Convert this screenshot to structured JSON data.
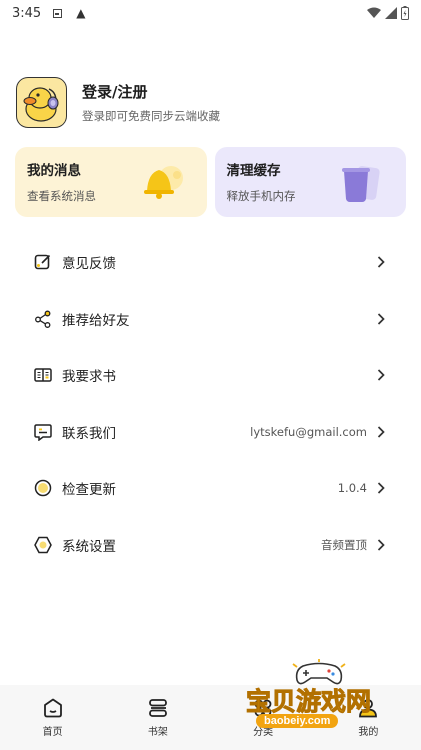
{
  "status_bar": {
    "time": "3:45",
    "warning_glyph": "▲"
  },
  "profile": {
    "title": "登录/注册",
    "subtitle": "登录即可免费同步云端收藏",
    "avatar_icon": "duck-avatar-icon"
  },
  "cards": {
    "messages": {
      "title": "我的消息",
      "subtitle": "查看系统消息",
      "background": "#fdf3d6",
      "accent": "#f5c518"
    },
    "cache": {
      "title": "清理缓存",
      "subtitle": "释放手机内存",
      "background": "#ebe8fb",
      "accent": "#8a7ad8"
    }
  },
  "menu": [
    {
      "icon": "edit-icon",
      "label": "意见反馈",
      "value": ""
    },
    {
      "icon": "share-icon",
      "label": "推荐给好友",
      "value": ""
    },
    {
      "icon": "book-icon",
      "label": "我要求书",
      "value": ""
    },
    {
      "icon": "chat-icon",
      "label": "联系我们",
      "value": "lytskefu@gmail.com"
    },
    {
      "icon": "update-icon",
      "label": "检查更新",
      "value": "1.0.4"
    },
    {
      "icon": "settings-icon",
      "label": "系统设置",
      "value": "音频置顶"
    }
  ],
  "tabs": [
    {
      "icon": "home-icon",
      "label": "首页"
    },
    {
      "icon": "bookshelf-icon",
      "label": "书架"
    },
    {
      "icon": "category-icon",
      "label": "分类"
    },
    {
      "icon": "profile-icon",
      "label": "我的"
    }
  ],
  "watermark": {
    "title": "宝贝游戏网",
    "url": "baobeiy.com"
  },
  "colors": {
    "accent_yellow": "#f5c518",
    "accent_purple": "#8a7ad8",
    "text_primary": "#222222",
    "text_secondary": "#555555"
  }
}
